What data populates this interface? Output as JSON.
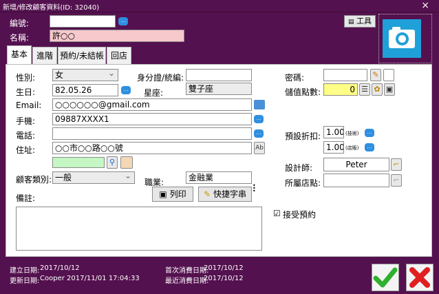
{
  "window": {
    "title": "新增/修改顧客資料(ID: 32040)",
    "close": "×"
  },
  "header": {
    "code_label": "編號:",
    "code_value": "",
    "name_label": "名稱:",
    "name_value": "許○○",
    "tools_label": "工具"
  },
  "tabs": [
    "基本",
    "進階",
    "預約/未結帳",
    "回店"
  ],
  "form": {
    "gender_label": "性別:",
    "gender_value": "女",
    "id_label": "身分證/統編:",
    "id_value": "",
    "birthday_label": "生日:",
    "birthday_value": "82.05.26",
    "zodiac_label": "星座:",
    "zodiac_value": "雙子座",
    "email_label": "Email:",
    "email_value": "○○○○○○@gmail.com",
    "mobile_label": "手機:",
    "mobile_value": "09887XXXX1",
    "phone_label": "電話:",
    "phone_value": "",
    "address_label": "住址:",
    "address_value": "○○市○○路○○號",
    "category_label": "顧客類別:",
    "category_value": "一般",
    "job_label": "職業:",
    "job_value": "金融業",
    "note_label": "備註:",
    "note_value": "",
    "print_label": "列印",
    "quick_label": "快捷字串",
    "password_label": "密碼:",
    "password_value": "",
    "points_label": "儲值點數:",
    "points_value": "0",
    "discount_label": "預設折扣:",
    "discount1_value": "1.00",
    "discount1_note": "(技術)",
    "discount2_value": "1.00",
    "discount2_note": "(店販)",
    "designer_label": "設計師:",
    "designer_value": "Peter",
    "store_label": "所屬店點:",
    "store_value": "",
    "accept_label": "接受預約",
    "accept_mark": "☑"
  },
  "footer": {
    "created_label": "建立日期:",
    "created_value": "2017/10/12",
    "updated_label": "更新日期:",
    "updated_value": "Cooper 2017/11/01 17:04:33",
    "first_label": "首次消費日期:",
    "first_value": "2017/10/12",
    "last_label": "最近消費日期:",
    "last_value": "2017/10/12"
  },
  "colors": {
    "window_bg": "#54114f",
    "ok": "#2fb02f",
    "cancel": "#e02020",
    "camera": "#1fa0d8"
  }
}
